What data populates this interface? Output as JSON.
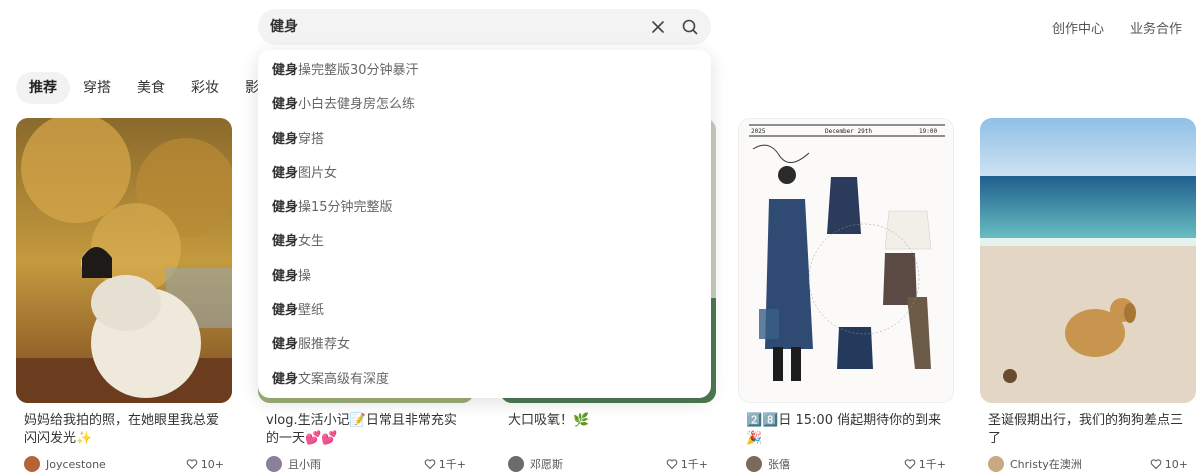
{
  "search": {
    "query": "健身",
    "clear_icon": "close-icon",
    "search_icon": "search-icon"
  },
  "header": {
    "links": [
      "创作中心",
      "业务合作"
    ]
  },
  "tabs": [
    "推荐",
    "穿搭",
    "美食",
    "彩妆",
    "影"
  ],
  "suggestions": [
    {
      "bold": "健身",
      "rest": "操完整版30分钟暴汗"
    },
    {
      "bold": "健身",
      "rest": "小白去健身房怎么练"
    },
    {
      "bold": "健身",
      "rest": "穿搭"
    },
    {
      "bold": "健身",
      "rest": "图片女"
    },
    {
      "bold": "健身",
      "rest": "操15分钟完整版"
    },
    {
      "bold": "健身",
      "rest": "女生"
    },
    {
      "bold": "健身",
      "rest": "操"
    },
    {
      "bold": "健身",
      "rest": "壁纸"
    },
    {
      "bold": "健身",
      "rest": "服推荐女"
    },
    {
      "bold": "健身",
      "rest": "文案高级有深度"
    }
  ],
  "cards": [
    {
      "title": "妈妈给我拍的照，在她眼里我总爱闪闪发光✨",
      "author": "Joycestone",
      "likes": "10+",
      "avatar_color": "#b7633a"
    },
    {
      "title": "vlog.生活小记📝日常且非常充实的一天💕💕",
      "author": "且小雨",
      "likes": "1千+",
      "avatar_color": "#8a7f9c"
    },
    {
      "title": "大口吸氧！🌿",
      "author": "邓愿斯",
      "likes": "1千+",
      "avatar_color": "#6b6b6b"
    },
    {
      "title": "2️⃣8️⃣日 15:00 俏起期待你的到来🎉",
      "author": "张僖",
      "likes": "1千+",
      "avatar_color": "#7a6a5a"
    },
    {
      "title": "圣诞假期出行，我们的狗狗差点三了",
      "author": "Christy在澳洲",
      "likes": "10+",
      "avatar_color": "#c9a982"
    }
  ],
  "card3_header": {
    "year": "2025",
    "date": "December 29th",
    "time": "19:00"
  }
}
